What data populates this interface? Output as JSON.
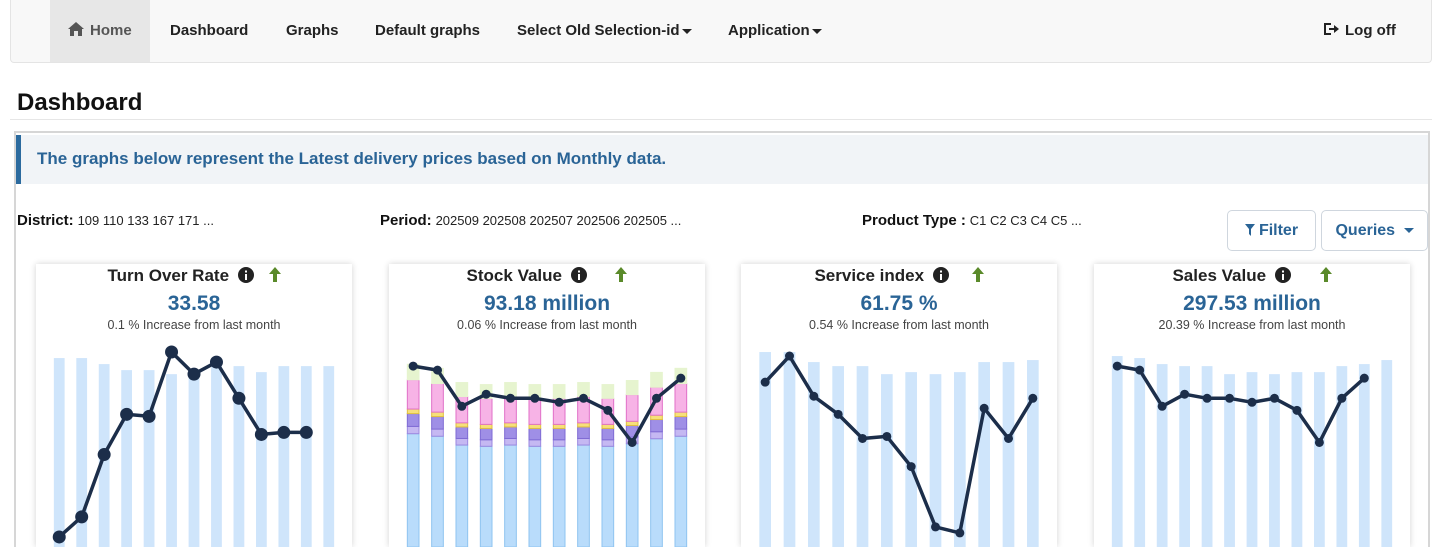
{
  "nav": {
    "home": "Home",
    "dashboard": "Dashboard",
    "graphs": "Graphs",
    "default_graphs": "Default graphs",
    "select_old": "Select Old Selection-id",
    "application": "Application",
    "logoff": "Log off"
  },
  "page": {
    "title": "Dashboard"
  },
  "alert": {
    "text": "The graphs below represent the Latest delivery prices based on Monthly data."
  },
  "filters": {
    "district_label": "District:",
    "district_value": "109 110 133 167 171 ...",
    "period_label": "Period:",
    "period_value": "202509 202508 202507 202506 202505 ...",
    "product_label": "Product Type :",
    "product_value": "C1 C2 C3 C4 C5 ..."
  },
  "buttons": {
    "filter": "Filter",
    "queries": "Queries"
  },
  "colors": {
    "accent": "#2a6496",
    "line": "#1c2e4a",
    "bar": "#cfe5fb",
    "trend_up": "#5a8a2a"
  },
  "cards": [
    {
      "title": "Turn Over Rate",
      "value": "33.58",
      "subtitle": "0.1 % Increase from last month"
    },
    {
      "title": "Stock Value",
      "value": "93.18 million",
      "subtitle": "0.06 % Increase from last month"
    },
    {
      "title": "Service index",
      "value": "61.75 %",
      "subtitle": "0.54 % Increase from last month"
    },
    {
      "title": "Sales Value",
      "value": "297.53 million",
      "subtitle": "20.39 % Increase from last month"
    }
  ],
  "chart_data": [
    {
      "type": "bar",
      "name_ref": "turnover",
      "bars": [
        0.94,
        0.94,
        0.91,
        0.88,
        0.88,
        0.86,
        0.87,
        0.92,
        0.9,
        0.87,
        0.9,
        0.9,
        0.9
      ],
      "line": [
        0.05,
        0.15,
        0.46,
        0.66,
        0.65,
        0.97,
        0.86,
        0.92,
        0.74,
        0.56,
        0.57,
        0.57
      ]
    },
    {
      "type": "bar",
      "name_ref": "stock",
      "bars": [
        0.9,
        0.88,
        0.81,
        0.8,
        0.81,
        0.8,
        0.8,
        0.81,
        0.8,
        0.82,
        0.86,
        0.88
      ],
      "line": [
        0.9,
        0.88,
        0.7,
        0.76,
        0.74,
        0.74,
        0.72,
        0.74,
        0.68,
        0.52,
        0.74,
        0.84
      ]
    },
    {
      "type": "bar",
      "name_ref": "service",
      "bars": [
        0.97,
        0.97,
        0.92,
        0.9,
        0.9,
        0.86,
        0.87,
        0.86,
        0.87,
        0.92,
        0.92,
        0.93
      ],
      "line": [
        0.82,
        0.95,
        0.75,
        0.66,
        0.54,
        0.55,
        0.4,
        0.1,
        0.07,
        0.69,
        0.54,
        0.74
      ]
    },
    {
      "type": "bar",
      "name_ref": "sales",
      "bars": [
        0.95,
        0.94,
        0.91,
        0.9,
        0.9,
        0.86,
        0.87,
        0.86,
        0.87,
        0.87,
        0.9,
        0.91,
        0.93
      ],
      "line": [
        0.9,
        0.88,
        0.7,
        0.76,
        0.74,
        0.74,
        0.72,
        0.74,
        0.68,
        0.52,
        0.74,
        0.84
      ]
    }
  ]
}
